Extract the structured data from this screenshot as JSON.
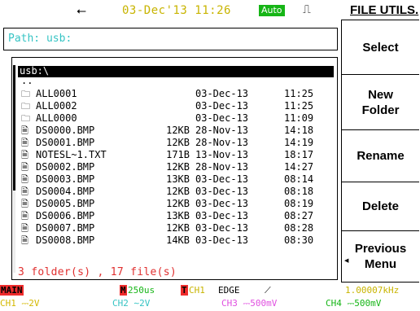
{
  "status": {
    "usb_icon": "⭠",
    "datetime": "03-Dec'13 11:26",
    "mode": "Auto",
    "trigger_icon": "⎍"
  },
  "menu": {
    "title": "FILE UTILS.",
    "buttons": [
      {
        "label": "Select"
      },
      {
        "label": "New\nFolder"
      },
      {
        "label": "Rename"
      },
      {
        "label": "Delete"
      },
      {
        "label": "Previous\nMenu"
      }
    ]
  },
  "path": "Path: usb:",
  "browser": {
    "drive": "usb:\\",
    "parent": "..",
    "files": [
      {
        "icon": "folder",
        "name": "ALL0001",
        "size": "",
        "date": "03-Dec-13",
        "time": "11:25"
      },
      {
        "icon": "folder",
        "name": "ALL0002",
        "size": "",
        "date": "03-Dec-13",
        "time": "11:25"
      },
      {
        "icon": "folder",
        "name": "ALL0000",
        "size": "",
        "date": "03-Dec-13",
        "time": "11:09"
      },
      {
        "icon": "file",
        "name": "DS0000.BMP",
        "size": "12KB",
        "date": "28-Nov-13",
        "time": "14:18"
      },
      {
        "icon": "file",
        "name": "DS0001.BMP",
        "size": "12KB",
        "date": "28-Nov-13",
        "time": "14:19"
      },
      {
        "icon": "file",
        "name": "NOTESL~1.TXT",
        "size": "171B",
        "date": "13-Nov-13",
        "time": "18:17"
      },
      {
        "icon": "file",
        "name": "DS0002.BMP",
        "size": "12KB",
        "date": "28-Nov-13",
        "time": "14:27"
      },
      {
        "icon": "file",
        "name": "DS0003.BMP",
        "size": "13KB",
        "date": "03-Dec-13",
        "time": "08:14"
      },
      {
        "icon": "file",
        "name": "DS0004.BMP",
        "size": "12KB",
        "date": "03-Dec-13",
        "time": "08:18"
      },
      {
        "icon": "file",
        "name": "DS0005.BMP",
        "size": "12KB",
        "date": "03-Dec-13",
        "time": "08:19"
      },
      {
        "icon": "file",
        "name": "DS0006.BMP",
        "size": "13KB",
        "date": "03-Dec-13",
        "time": "08:27"
      },
      {
        "icon": "file",
        "name": "DS0007.BMP",
        "size": "12KB",
        "date": "03-Dec-13",
        "time": "08:28"
      },
      {
        "icon": "file",
        "name": "DS0008.BMP",
        "size": "14KB",
        "date": "03-Dec-13",
        "time": "08:30"
      }
    ],
    "summary": "3 folder(s) , 17 file(s)"
  },
  "bottom": {
    "main": "MAIN",
    "m_badge": "M",
    "timebase": "250us",
    "t_badge": "T",
    "trigger_source": "CH1",
    "trigger_type": "EDGE",
    "trigger_slope": "⟋",
    "frequency": "1.00007kHz",
    "ch1": "CH1 ⎓2V",
    "ch2": "CH2 ∼2V",
    "ch3": "CH3 ⎓500mV",
    "ch4": "CH4 ⎓500mV"
  },
  "colors": {
    "yellow": "#c8b400",
    "cyan": "#36c4c4",
    "green": "#16b516",
    "red": "#ef2c2c",
    "magenta": "#e050e0"
  }
}
